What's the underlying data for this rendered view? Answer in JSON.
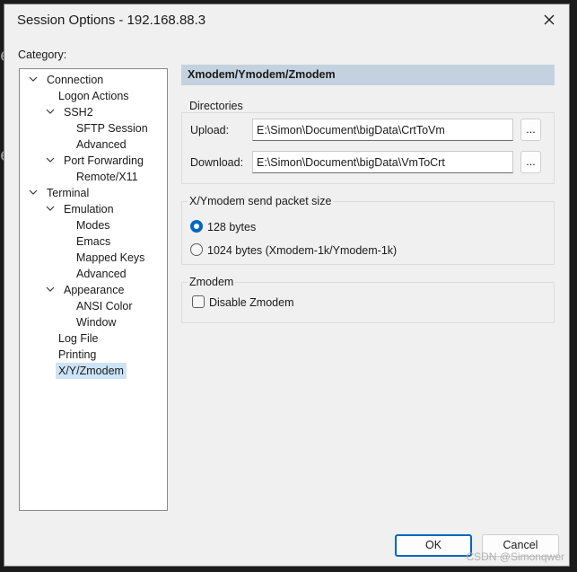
{
  "window": {
    "title": "Session Options - 192.168.88.3"
  },
  "category_label": "Category:",
  "tree": [
    {
      "label": "Connection",
      "expanded": true
    },
    {
      "label": "Logon Actions"
    },
    {
      "label": "SSH2",
      "expanded": true
    },
    {
      "label": "SFTP Session"
    },
    {
      "label": "Advanced"
    },
    {
      "label": "Port Forwarding",
      "expanded": true
    },
    {
      "label": "Remote/X11"
    },
    {
      "label": "Terminal",
      "expanded": true
    },
    {
      "label": "Emulation",
      "expanded": true
    },
    {
      "label": "Modes"
    },
    {
      "label": "Emacs"
    },
    {
      "label": "Mapped Keys"
    },
    {
      "label": "Advanced"
    },
    {
      "label": "Appearance",
      "expanded": true
    },
    {
      "label": "ANSI Color"
    },
    {
      "label": "Window"
    },
    {
      "label": "Log File"
    },
    {
      "label": "Printing"
    },
    {
      "label": "X/Y/Zmodem",
      "selected": true
    }
  ],
  "panel": {
    "header": "Xmodem/Ymodem/Zmodem",
    "directories": {
      "title": "Directories",
      "upload_label": "Upload:",
      "upload_value": "E:\\Simon\\Document\\bigData\\CrtToVm",
      "download_label": "Download:",
      "download_value": "E:\\Simon\\Document\\bigData\\VmToCrt",
      "browse_label": "..."
    },
    "packet_size": {
      "title": "X/Ymodem send packet size",
      "option_128": "128 bytes",
      "option_1024": "1024 bytes  (Xmodem-1k/Ymodem-1k)",
      "selected": "128 bytes"
    },
    "zmodem": {
      "title": "Zmodem",
      "disable_label": "Disable Zmodem",
      "disable_checked": false
    }
  },
  "buttons": {
    "ok": "OK",
    "cancel": "Cancel"
  },
  "watermark": "CSDN @Simonqwer",
  "background_glyph": "e",
  "colors": {
    "accent": "#0067c0",
    "header_bg": "#c4d2e0",
    "selection": "#cce4f7",
    "dialog_bg": "#f0f0f0"
  }
}
